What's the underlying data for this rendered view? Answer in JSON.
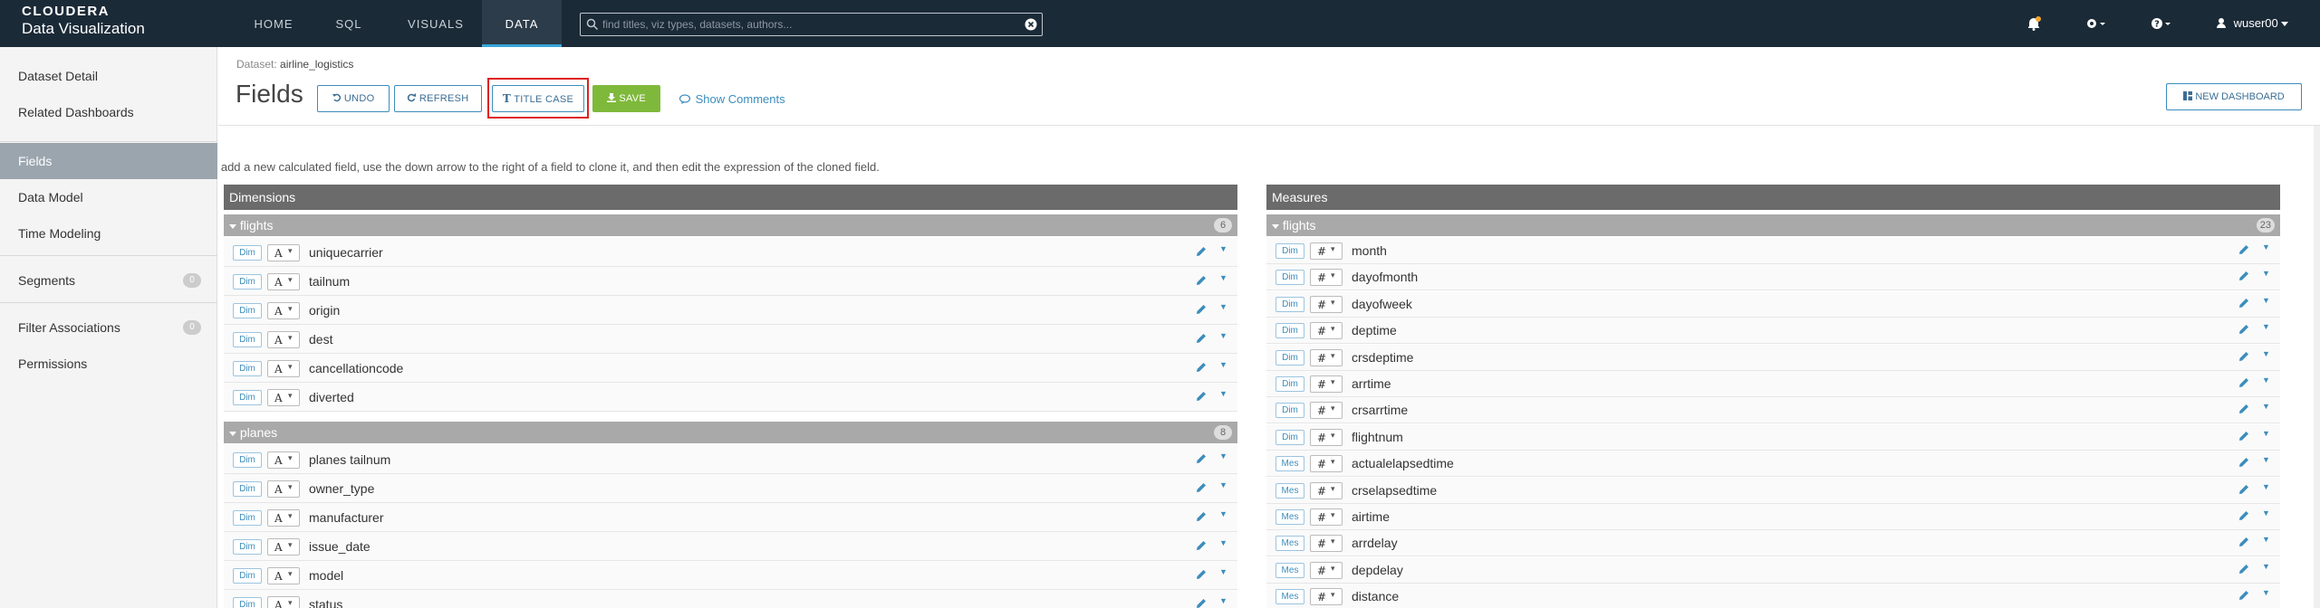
{
  "brand": {
    "line1": "CLOUDERA",
    "line2": "Data Visualization"
  },
  "nav": {
    "tabs": [
      "HOME",
      "SQL",
      "VISUALS",
      "DATA"
    ],
    "active": "DATA"
  },
  "search": {
    "placeholder": "find titles, viz types, datasets, authors..."
  },
  "user": {
    "name": "wuser00"
  },
  "sidebar": {
    "items": [
      "Dataset Detail",
      "Related Dashboards",
      "Fields",
      "Data Model",
      "Time Modeling",
      "Segments",
      "Filter Associations",
      "Permissions"
    ],
    "segments_count": "0",
    "filter_count": "0"
  },
  "header": {
    "dataset_label": "Dataset:",
    "dataset_name": "airline_logistics",
    "title": "Fields",
    "undo": "UNDO",
    "refresh": "REFRESH",
    "title_case": "TITLE CASE",
    "save": "SAVE",
    "show_comments": "Show Comments",
    "new_dashboard": "NEW DASHBOARD"
  },
  "hint": "o add a new calculated field, use the down arrow to the right of a field to clone it, and then edit the expression of the cloned field.",
  "dimensions": {
    "title": "Dimensions",
    "groups": [
      {
        "name": "flights",
        "count": "6",
        "fields": [
          "uniquecarrier",
          "tailnum",
          "origin",
          "dest",
          "cancellationcode",
          "diverted"
        ]
      },
      {
        "name": "planes",
        "count": "8",
        "fields": [
          "planes tailnum",
          "owner_type",
          "manufacturer",
          "issue_date",
          "model",
          "status"
        ]
      }
    ],
    "role": "Dim",
    "type_glyph": "A"
  },
  "measures": {
    "title": "Measures",
    "group": {
      "name": "flights",
      "count": "23"
    },
    "fields": [
      {
        "role": "Dim",
        "name": "month"
      },
      {
        "role": "Dim",
        "name": "dayofmonth"
      },
      {
        "role": "Dim",
        "name": "dayofweek"
      },
      {
        "role": "Dim",
        "name": "deptime"
      },
      {
        "role": "Dim",
        "name": "crsdeptime"
      },
      {
        "role": "Dim",
        "name": "arrtime"
      },
      {
        "role": "Dim",
        "name": "crsarrtime"
      },
      {
        "role": "Dim",
        "name": "flightnum"
      },
      {
        "role": "Mes",
        "name": "actualelapsedtime"
      },
      {
        "role": "Mes",
        "name": "crselapsedtime"
      },
      {
        "role": "Mes",
        "name": "airtime"
      },
      {
        "role": "Mes",
        "name": "arrdelay"
      },
      {
        "role": "Mes",
        "name": "depdelay"
      },
      {
        "role": "Mes",
        "name": "distance"
      }
    ],
    "type_glyph": "#"
  }
}
